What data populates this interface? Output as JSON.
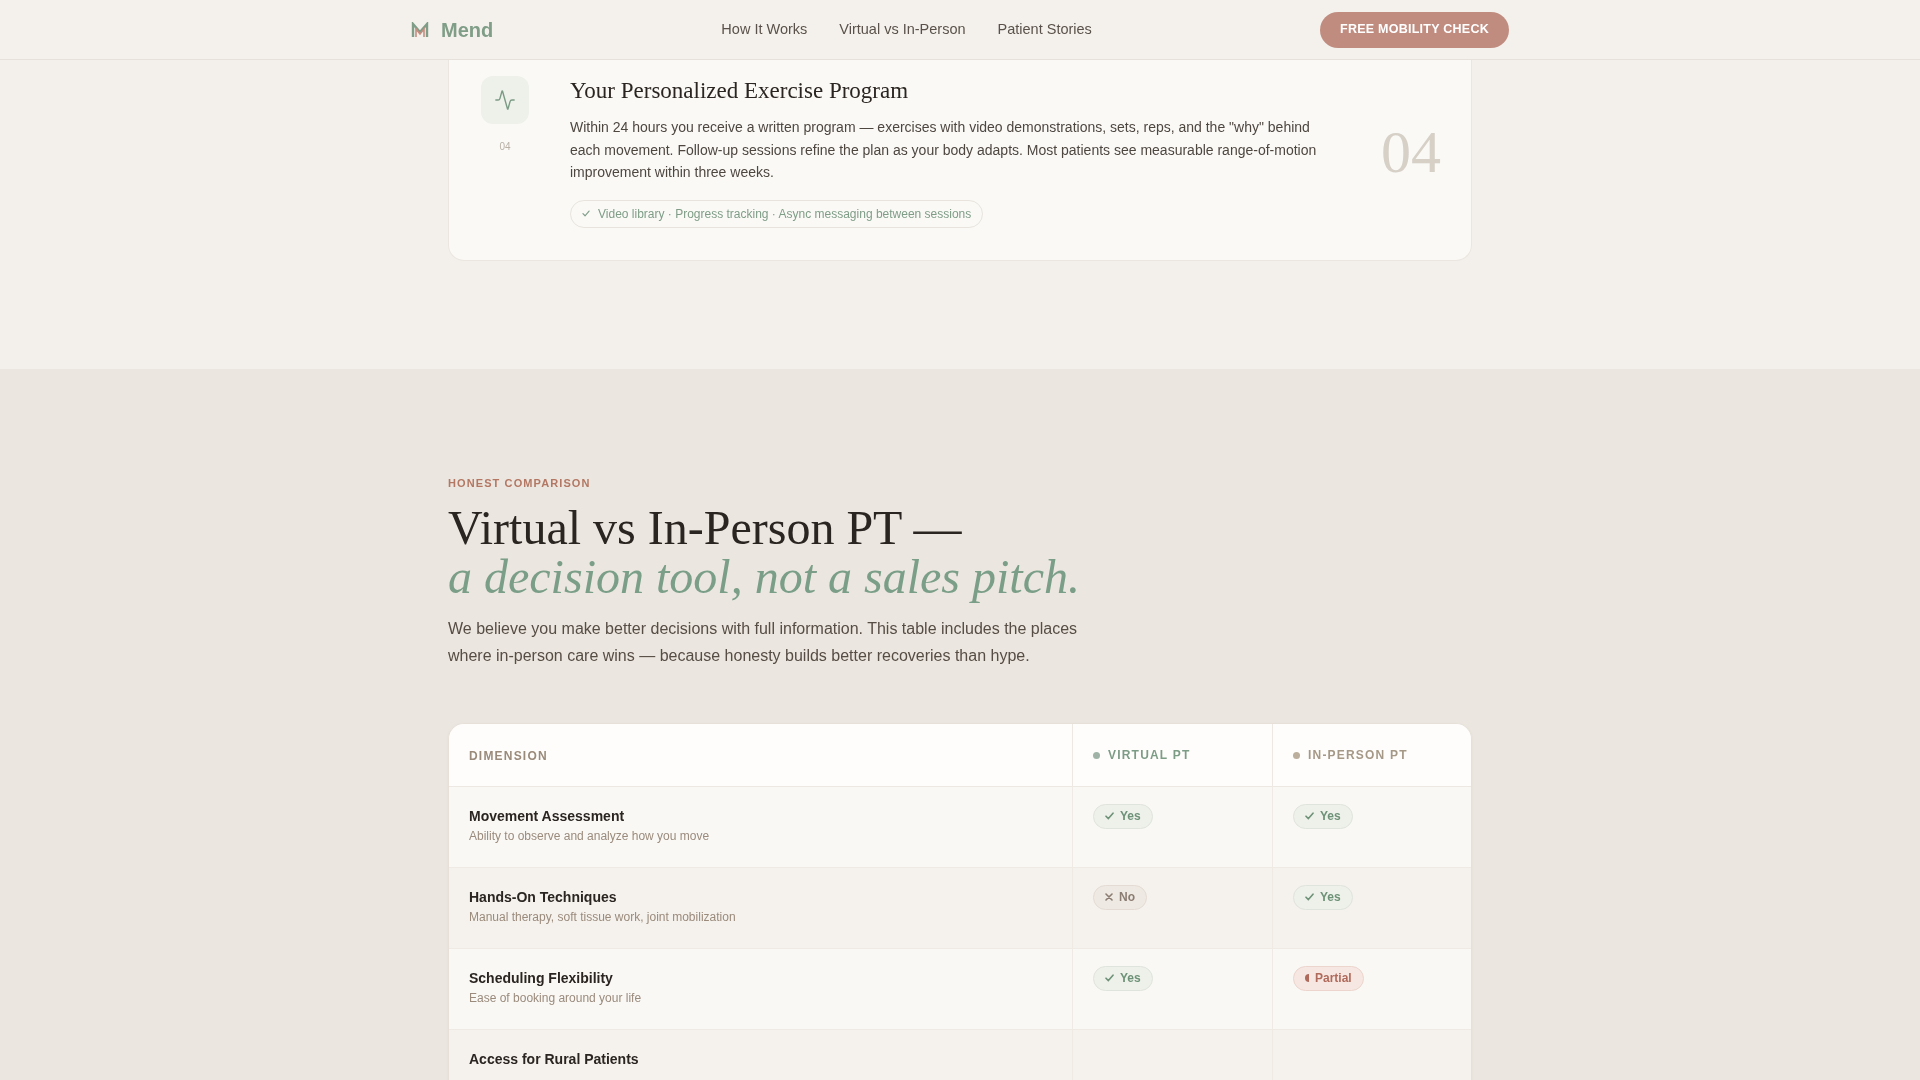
{
  "header": {
    "logo": "Mend",
    "nav": [
      {
        "label": "How It Works"
      },
      {
        "label": "Virtual vs In-Person"
      },
      {
        "label": "Patient Stories"
      }
    ],
    "cta": "FREE MOBILITY CHECK"
  },
  "program_step": {
    "number": "04",
    "title": "Your Personalized Exercise Program",
    "description": "Within 24 hours you receive a written program — exercises with video demonstrations, sets, reps, and the \"why\" behind each movement. Follow-up sessions refine the plan as your body adapts. Most patients see measurable range-of-motion improvement within three weeks.",
    "features": "Video library · Progress tracking · Async messaging between sessions",
    "big_number": "04"
  },
  "comparison": {
    "eyebrow": "HONEST COMPARISON",
    "title": "Virtual vs In-Person PT —",
    "title_emphasis": "a decision tool, not a sales pitch.",
    "intro": "We believe you make better decisions with full information. This table includes the places where in-person care wins — because honesty builds better recoveries than hype.",
    "table": {
      "columns": [
        {
          "label": "DIMENSION"
        },
        {
          "label": "VIRTUAL PT",
          "color": "#9fb4a6"
        },
        {
          "label": "IN-PERSON PT",
          "color": "#bcae9c"
        }
      ],
      "rows": [
        {
          "title": "Movement Assessment",
          "subtitle": "Ability to observe and analyze how you move",
          "cells": [
            {
              "kind": "yes",
              "label": "Yes"
            },
            {
              "kind": "yes",
              "label": "Yes"
            }
          ]
        },
        {
          "title": "Hands-On Techniques",
          "subtitle": "Manual therapy, soft tissue work, joint mobilization",
          "cells": [
            {
              "kind": "no",
              "label": "No"
            },
            {
              "kind": "yes",
              "label": "Yes"
            }
          ]
        },
        {
          "title": "Scheduling Flexibility",
          "subtitle": "Ease of booking around your life",
          "cells": [
            {
              "kind": "yes",
              "label": "Yes"
            },
            {
              "kind": "partial",
              "label": "Partial"
            }
          ]
        },
        {
          "title": "Access for Rural Patients"
        }
      ]
    }
  }
}
